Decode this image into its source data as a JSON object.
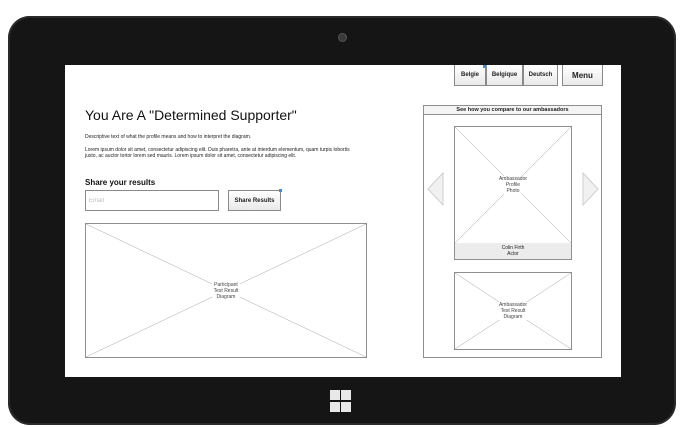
{
  "languages": [
    {
      "label": "Belgie"
    },
    {
      "label": "Belgique"
    },
    {
      "label": "Deutsch"
    }
  ],
  "menu_label": "Menu",
  "title": "You Are A \"Determined Supporter\"",
  "description": "Descriptive text of what the profile means and how to interpret the diagram.",
  "lorem": "Lorem ipsum dolor sit amet, consectetur adipiscing elit. Duis pharetra, ante at interdum elementum, quam turpis lobortis justo, ac auctor tortor lorem sed mauris. Lorem ipsum dolor sit amet, consectetur adipiscing elit.",
  "share": {
    "heading": "Share your results",
    "email_placeholder": "Email",
    "button_label": "Share Results"
  },
  "participant_diagram_label": "Participant\nTest Result\nDiagram",
  "ambassadors": {
    "header": "See how you compare to our ambassadors",
    "photo_label": "Ambassador\nProfile\nPhoto",
    "name": "Colin Firth",
    "role": "Actor",
    "diagram_label": "Ambassador\nTest Result\nDiagram"
  }
}
